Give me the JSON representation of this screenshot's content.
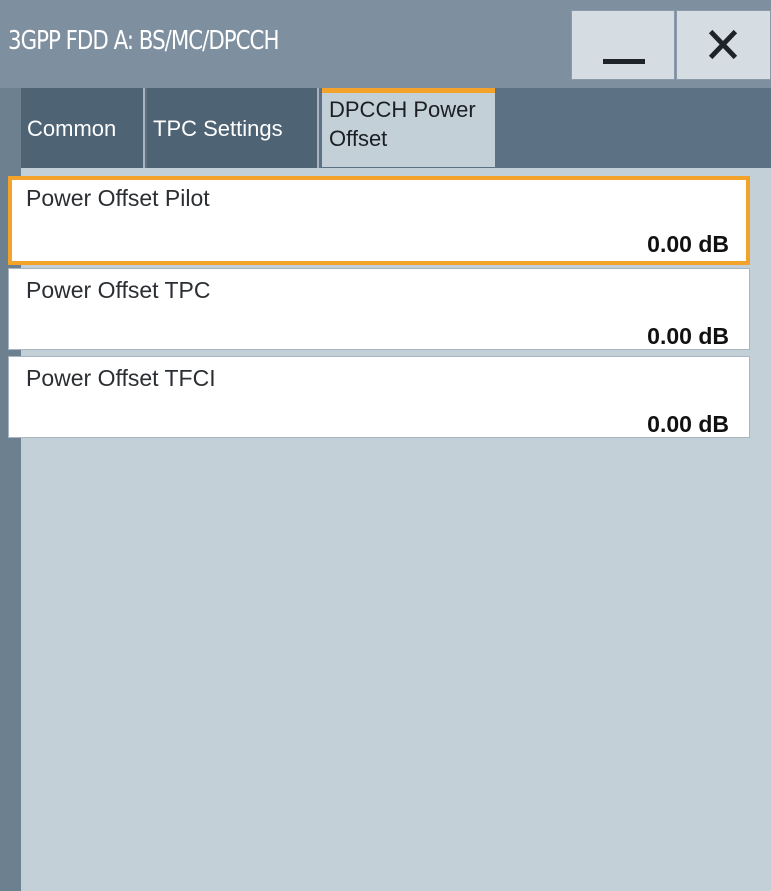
{
  "window": {
    "title": "3GPP FDD A: BS/MC/DPCCH",
    "minimize_icon": "minimize-icon",
    "close_icon": "close-icon"
  },
  "tabs": [
    {
      "label": "Common",
      "active": false
    },
    {
      "label": "TPC Settings",
      "active": false
    },
    {
      "label": "DPCCH Power Offset",
      "active": true
    }
  ],
  "fields": [
    {
      "label": "Power Offset Pilot",
      "value": "0.00 dB",
      "focused": true
    },
    {
      "label": "Power Offset TPC",
      "value": "0.00 dB",
      "focused": false
    },
    {
      "label": "Power Offset TFCI",
      "value": "0.00 dB",
      "focused": false
    }
  ],
  "colors": {
    "accent": "#f3a32a",
    "titlebar": "#7e8fa0",
    "tab_inactive": "#4e6373",
    "panel": "#c4d0d8"
  }
}
